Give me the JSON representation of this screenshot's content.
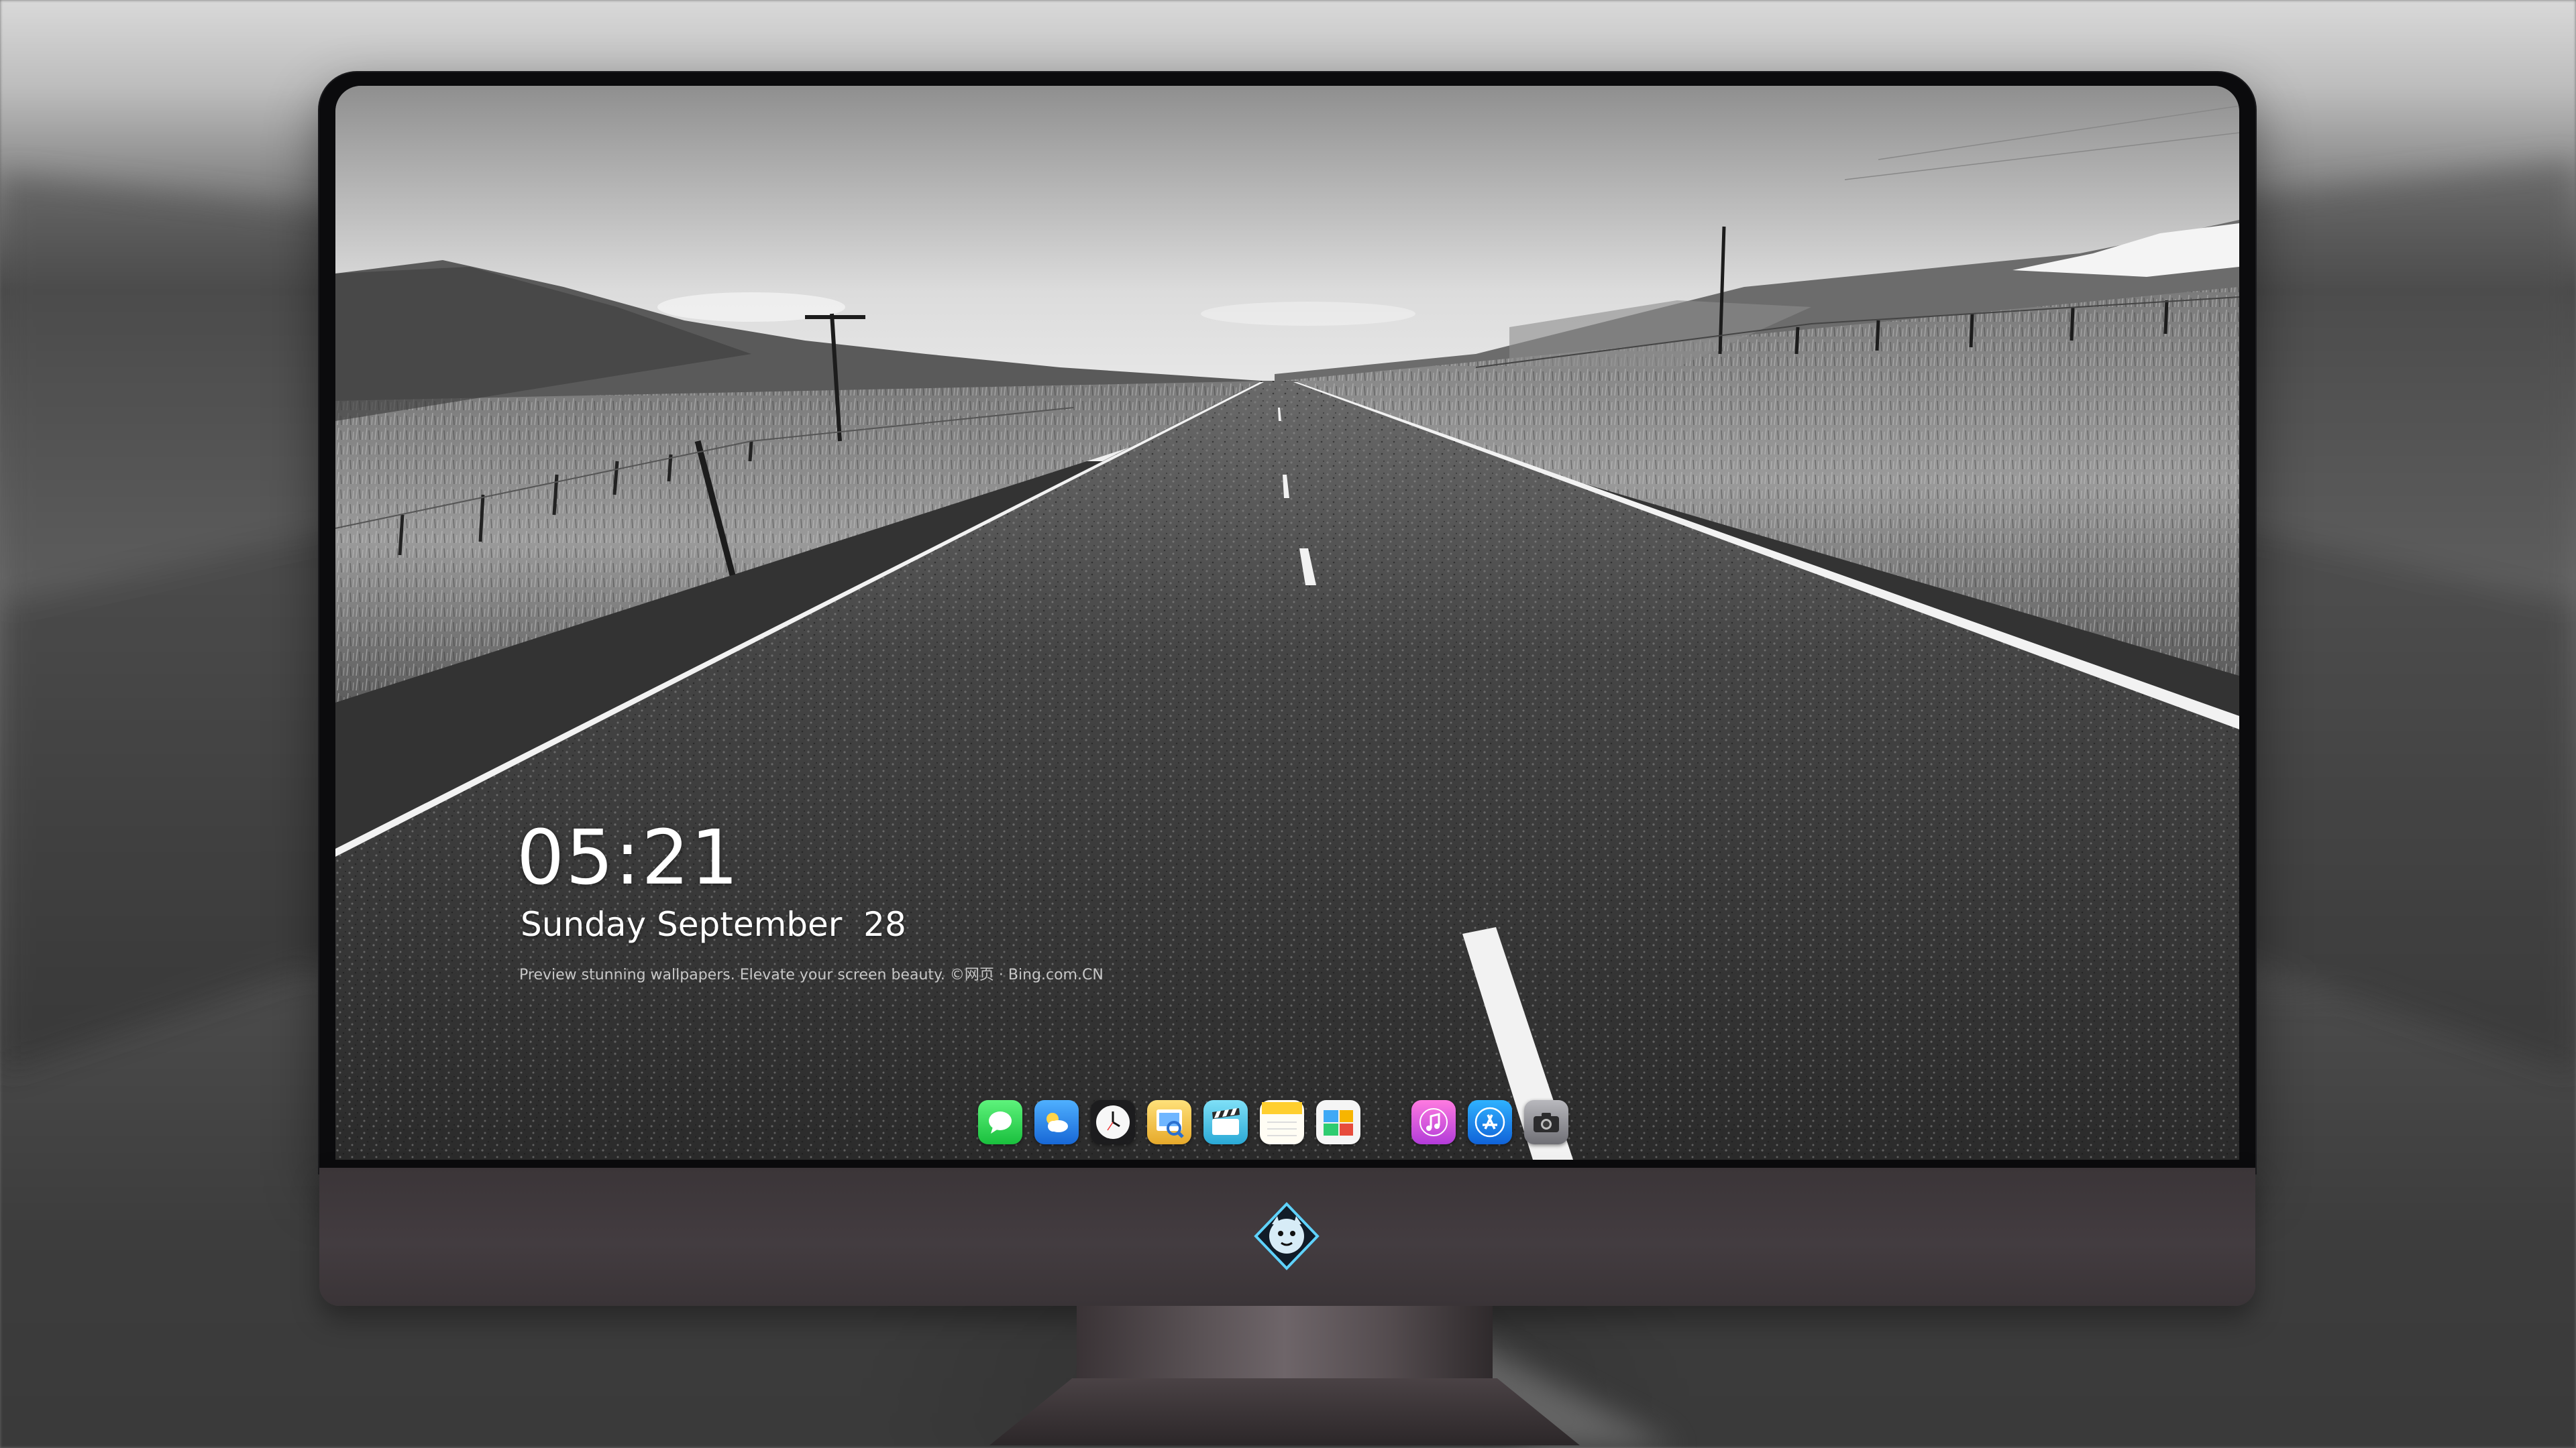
{
  "lock_screen": {
    "time": "05:21",
    "date": "Sunday September  28",
    "tagline": "Preview stunning wallpapers. Elevate your screen beauty. ©网页 · Bing.com.CN"
  },
  "wallpaper": {
    "subject": "black-and-white open road through grassland"
  },
  "dock": {
    "apps": [
      {
        "name": "messages-icon",
        "color": "#2fd158"
      },
      {
        "name": "weather-icon",
        "color": "#2d8df0"
      },
      {
        "name": "clock-icon",
        "color": "#1c1c1e"
      },
      {
        "name": "preview-icon",
        "color": "#f2c94c"
      },
      {
        "name": "video-editor-icon",
        "color": "#4fc3e8"
      },
      {
        "name": "notes-icon",
        "color": "#ffd84a"
      },
      {
        "name": "photo-gallery-icon",
        "color": "#f5f5f5"
      },
      {
        "name": "music-icon",
        "color": "#e84cbd"
      },
      {
        "name": "app-store-icon",
        "color": "#1e90ff"
      },
      {
        "name": "camera-icon",
        "color": "#8e8e93"
      }
    ]
  },
  "hardware": {
    "chin_logo": "brand-emblem-icon",
    "bezel_color": "#0b0b0d",
    "chin_color": "#403a3d"
  }
}
